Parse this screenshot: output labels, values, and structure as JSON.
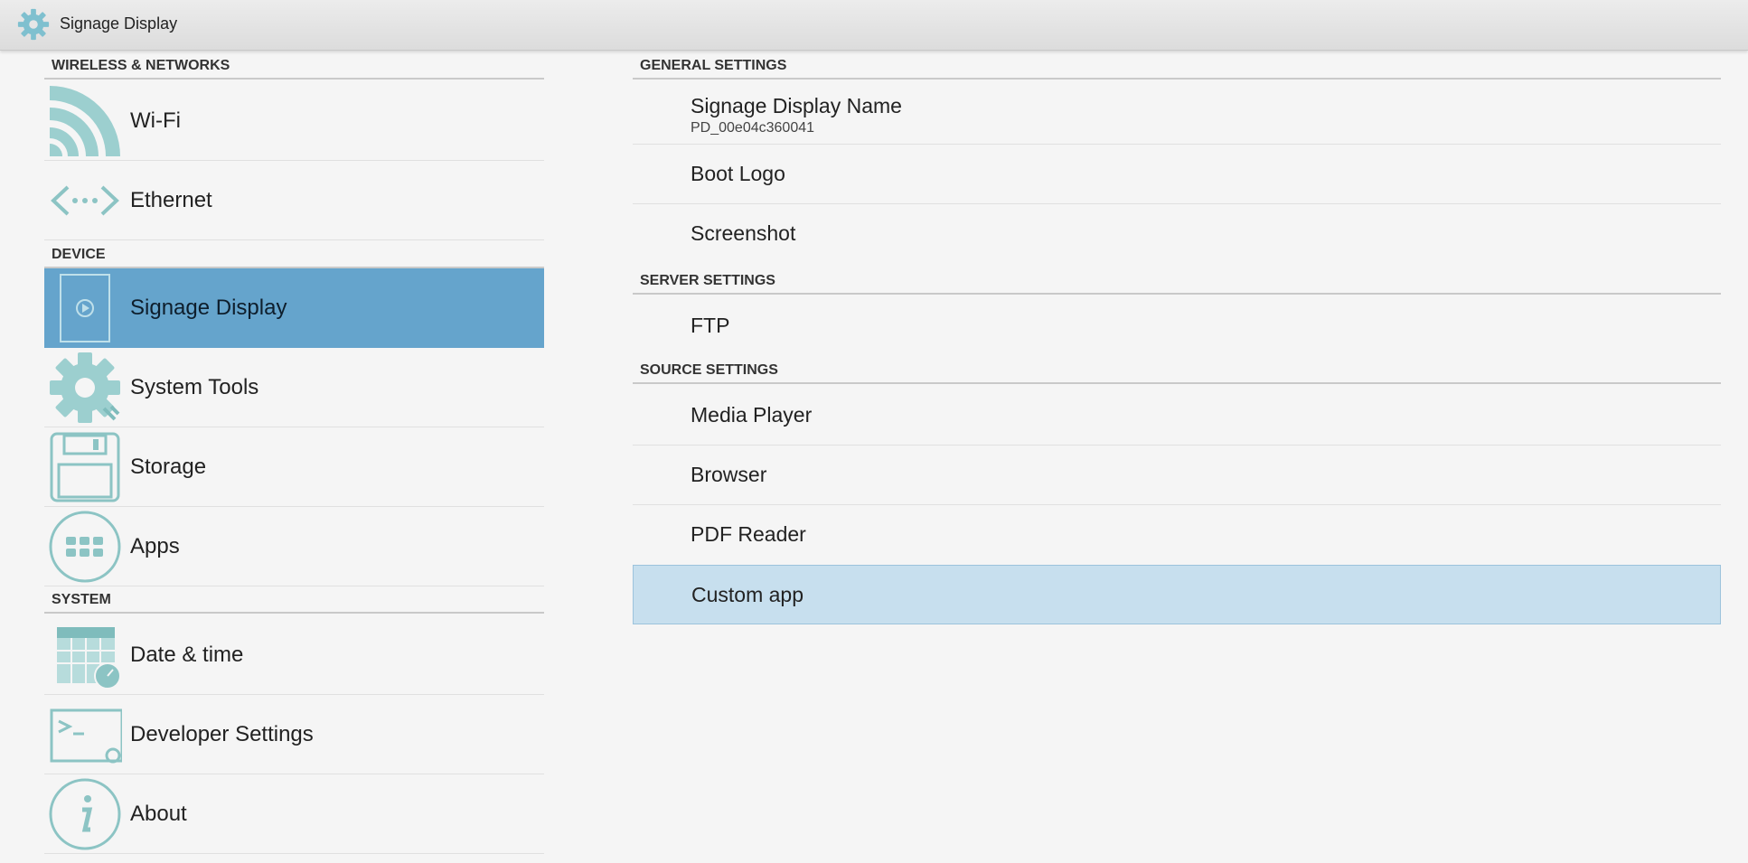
{
  "titlebar": {
    "title": "Signage Display",
    "icon": "gear-icon"
  },
  "colors": {
    "selected_left": "#65a4cc",
    "selected_right": "#c7dfee",
    "icon_teal": "#9ccfcf"
  },
  "left_panel": {
    "sections": [
      {
        "header": "WIRELESS & NETWORKS",
        "items": [
          {
            "label": "Wi-Fi",
            "icon": "wifi-icon"
          },
          {
            "label": "Ethernet",
            "icon": "ethernet-icon"
          }
        ]
      },
      {
        "header": "DEVICE",
        "items": [
          {
            "label": "Signage Display",
            "icon": "signage-display-icon",
            "selected": true
          },
          {
            "label": "System Tools",
            "icon": "system-tools-icon"
          },
          {
            "label": "Storage",
            "icon": "storage-icon"
          },
          {
            "label": "Apps",
            "icon": "apps-icon"
          }
        ]
      },
      {
        "header": "SYSTEM",
        "items": [
          {
            "label": "Date & time",
            "icon": "calendar-clock-icon"
          },
          {
            "label": "Developer Settings",
            "icon": "terminal-icon"
          },
          {
            "label": "About",
            "icon": "info-icon"
          }
        ]
      }
    ]
  },
  "right_panel": {
    "sections": [
      {
        "header": "GENERAL SETTINGS",
        "items": [
          {
            "label": "Signage Display Name",
            "sub": "PD_00e04c360041"
          },
          {
            "label": "Boot Logo"
          },
          {
            "label": "Screenshot"
          }
        ]
      },
      {
        "header": "SERVER SETTINGS",
        "items": [
          {
            "label": "FTP"
          }
        ]
      },
      {
        "header": "SOURCE SETTINGS",
        "items": [
          {
            "label": "Media Player"
          },
          {
            "label": "Browser"
          },
          {
            "label": "PDF Reader"
          },
          {
            "label": "Custom app",
            "selected": true
          }
        ]
      }
    ]
  }
}
